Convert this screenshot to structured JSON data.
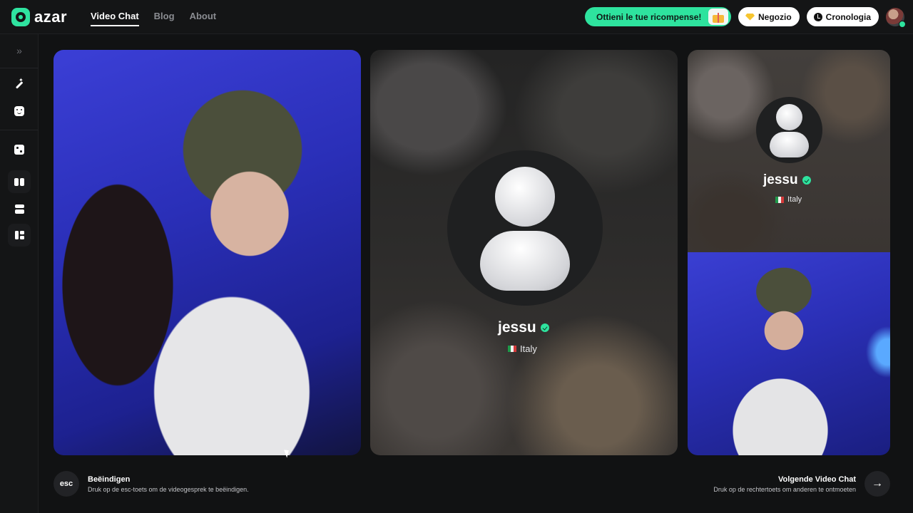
{
  "header": {
    "logo_text": "azar",
    "nav": [
      {
        "label": "Video Chat",
        "active": true
      },
      {
        "label": "Blog",
        "active": false
      },
      {
        "label": "About",
        "active": false
      }
    ],
    "reward_label": "Ottieni le tue ricompense!",
    "shop_label": "Negozio",
    "history_label": "Cronologia",
    "icons": {
      "shop": "diamond-icon",
      "history": "clock-icon",
      "reward": "gift-icon"
    }
  },
  "sidebar": {
    "icons": [
      "expand-chevron-icon",
      "magic-wand-icon",
      "face-filter-icon",
      "random-dice-icon",
      "layout-columns-icon",
      "layout-rows-icon",
      "layout-grid-icon"
    ]
  },
  "match": {
    "username": "jessu",
    "country": "Italy",
    "flag_colors": [
      "#1f9a4a",
      "#f2f2f2",
      "#d43a3a"
    ]
  },
  "footer": {
    "esc_key": "esc",
    "end_title": "Beëindigen",
    "end_desc": "Druk op de esc-toets om de videogesprek te beëindigen.",
    "next_title": "Volgende Video Chat",
    "next_desc": "Druk op de rechtertoets om anderen te ontmoeten",
    "next_icon": "→"
  },
  "colors": {
    "accent": "#2ee39e",
    "background": "#111213"
  }
}
